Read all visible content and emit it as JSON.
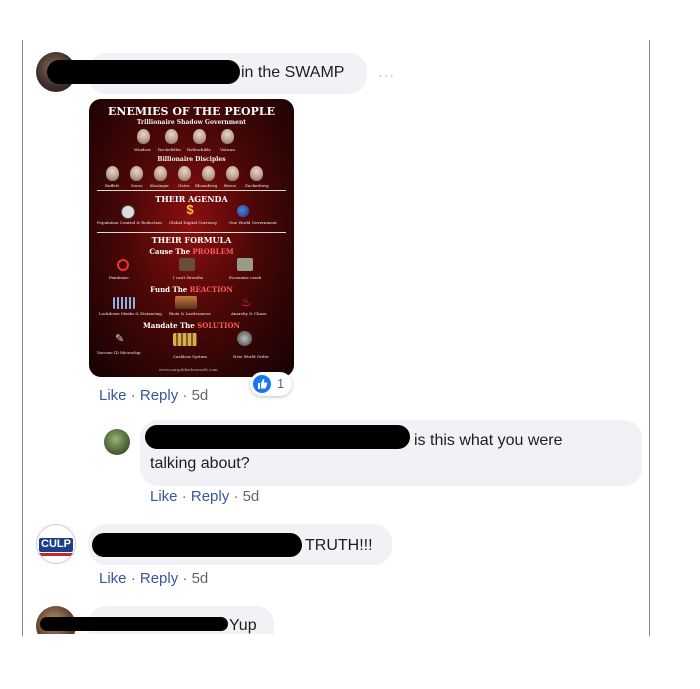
{
  "comments": [
    {
      "text": "in the SWAMP",
      "more": "···"
    },
    {
      "text": "is this what you were",
      "text2": "talking about?"
    },
    {
      "text": "TRUTH!!!",
      "avatar_text": "CULP"
    },
    {
      "text": "Yup"
    }
  ],
  "actions": {
    "like": "Like",
    "reply": "Reply",
    "sep": "·",
    "age": "5d"
  },
  "reaction": {
    "count": "1",
    "icon": "thumbs-up-icon",
    "color": "#1877f2"
  },
  "poster": {
    "title": "ENEMIES OF THE PEOPLE",
    "s1": "Trillionaire Shadow Government",
    "s1_names": [
      "Windsor",
      "Rockefeller",
      "Rothschilds",
      "Vatican"
    ],
    "s2": "Billionaire Disciples",
    "s2_names": [
      "Buffett",
      "Soros",
      "Kissinger",
      "Gates",
      "Bloomberg",
      "Bezos",
      "Zuckerberg"
    ],
    "agenda_a": "THEIR",
    "agenda_b": "AGENDA",
    "agenda_items": [
      "Population Control & Reduction",
      "Global Digital Currency",
      "One World Government"
    ],
    "formula_a": "THEIR",
    "formula_b": "FORMULA",
    "cause_a": "Cause The",
    "cause_b": "PROBLEM",
    "cause_items": [
      "Pandemic",
      "I can't Breathe",
      "Economic crash"
    ],
    "fund_a": "Fund The",
    "fund_b": "REACTION",
    "fund_items": [
      "Lockdown Masks & Distancing",
      "Riots & Lawlessness",
      "Anarchy & Chaos"
    ],
    "mandate_a": "Mandate The",
    "mandate_b": "SOLUTION",
    "mandate_items": [
      "Vaccine ID Microchip",
      "Cashless System",
      "New World Order"
    ],
    "url": "www.ourgoldenlonerath.com"
  }
}
